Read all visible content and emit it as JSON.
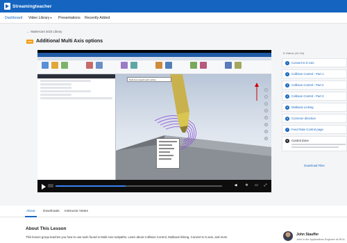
{
  "brand": {
    "name": "Streamingteacher",
    "color": "#1565c0"
  },
  "nav": {
    "items": [
      {
        "label": "Dashboard",
        "active": true
      },
      {
        "label": "Video Library",
        "has_caret": true
      },
      {
        "label": "Presentations"
      },
      {
        "label": "Recently Added"
      }
    ]
  },
  "breadcrumb": {
    "label": "Mastercam 2023 Library"
  },
  "lesson": {
    "badge": "new",
    "title": "Additional Multi Axis options"
  },
  "video": {
    "viewport_tooltip": "Multi Axis toolpath path surface",
    "progress_fraction": 0.42
  },
  "playlist": {
    "count_label": "8 Videos (1h 2m)",
    "items": [
      {
        "num": "1",
        "label": "Convert to 5 Axis"
      },
      {
        "num": "2",
        "label": "Collision Control - Part 1"
      },
      {
        "num": "3",
        "label": "Collision Control - Part 2"
      },
      {
        "num": "4",
        "label": "Collision Control - Part 3"
      },
      {
        "num": "5",
        "label": "Multiaxis Linking"
      },
      {
        "num": "6",
        "label": "Common direction"
      },
      {
        "num": "7",
        "label": "Feed Rate Control page"
      },
      {
        "num": "8",
        "label": "Control Zone",
        "current": true
      }
    ],
    "download_label": "Download Files"
  },
  "tabs": [
    {
      "label": "About",
      "active": true
    },
    {
      "label": "Downloads"
    },
    {
      "label": "Instructor Notes"
    }
  ],
  "about": {
    "title": "About This Lesson",
    "text": "This lesson group teaches you how to use tools found in Multi Axis toolpaths. Learn about Collision Control, Multiaxis linking, Convert to 5 axis, and more"
  },
  "author": {
    "name": "John Stauffer",
    "role": "John is the Applications Engineer at MCA"
  },
  "icons": {
    "play": "play-icon",
    "volume": "volume-icon",
    "settings": "gear-icon",
    "fullscreen": "fullscreen-icon"
  }
}
